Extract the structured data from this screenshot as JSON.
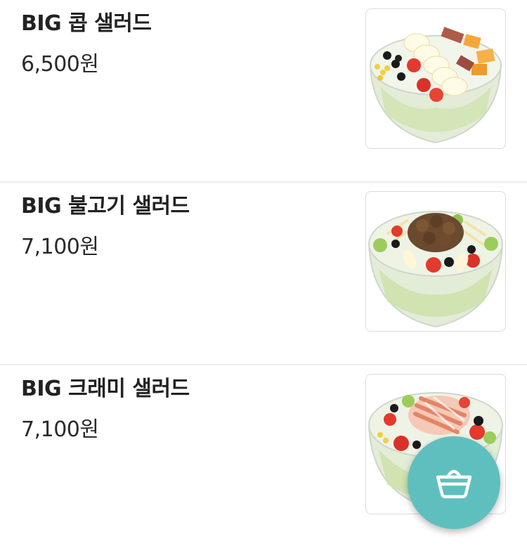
{
  "menu": {
    "items": [
      {
        "name": "BIG 콥 샐러드",
        "price": "6,500원",
        "image": "cobb-salad-image"
      },
      {
        "name": "BIG 불고기 샐러드",
        "price": "7,100원",
        "image": "bulgogi-salad-image"
      },
      {
        "name": "BIG 크래미 샐러드",
        "price": "7,100원",
        "image": "crab-salad-image"
      }
    ]
  },
  "cart_button": {
    "icon": "shopping-basket-icon",
    "color": "#5fbfbf"
  },
  "colors": {
    "divider": "#eeeeee",
    "text": "#222222",
    "accent": "#5fbfbf"
  }
}
